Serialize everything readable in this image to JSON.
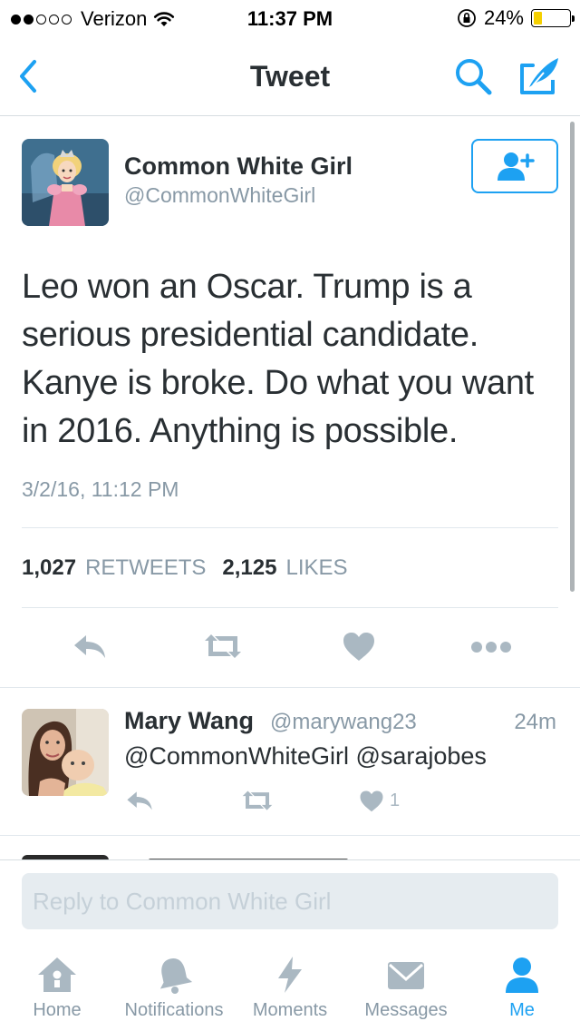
{
  "status_bar": {
    "carrier": "Verizon",
    "time": "11:37 PM",
    "battery": "24%",
    "battery_level": 0.24,
    "signal_bars": 2
  },
  "nav": {
    "title": "Tweet",
    "back_icon": "chevron-left-icon",
    "search_icon": "search-icon",
    "compose_icon": "compose-icon"
  },
  "tweet": {
    "author_name": "Common White Girl",
    "author_handle": "@CommonWhiteGirl",
    "text": "Leo won an Oscar. Trump is a serious presidential candidate. Kanye is broke. Do what you want in 2016. Anything is possible.",
    "timestamp": "3/2/16, 11:12 PM",
    "retweet_count": "1,027",
    "retweet_label": "RETWEETS",
    "like_count": "2,125",
    "like_label": "LIKES"
  },
  "reply": {
    "author_name": "Mary Wang",
    "author_handle": "@marywang23",
    "time": "24m",
    "text": "@CommonWhiteGirl @sarajobes",
    "like_count": "1"
  },
  "reply_box": {
    "placeholder": "Reply to Common White Girl"
  },
  "tabs": [
    {
      "label": "Home",
      "icon": "home-icon"
    },
    {
      "label": "Notifications",
      "icon": "bell-icon"
    },
    {
      "label": "Moments",
      "icon": "lightning-icon"
    },
    {
      "label": "Messages",
      "icon": "envelope-icon"
    },
    {
      "label": "Me",
      "icon": "person-icon",
      "active": true
    }
  ],
  "colors": {
    "accent": "#1da1f2",
    "text": "#292f33",
    "muted": "#8899a6",
    "icon_gray": "#aab8c2",
    "battery_fill": "#f5d000"
  }
}
